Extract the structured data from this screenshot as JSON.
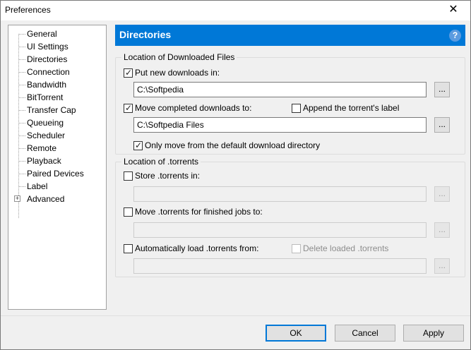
{
  "window": {
    "title": "Preferences",
    "close_glyph": "✕"
  },
  "tree": {
    "items": [
      {
        "label": "General"
      },
      {
        "label": "UI Settings"
      },
      {
        "label": "Directories"
      },
      {
        "label": "Connection"
      },
      {
        "label": "Bandwidth"
      },
      {
        "label": "BitTorrent"
      },
      {
        "label": "Transfer Cap"
      },
      {
        "label": "Queueing"
      },
      {
        "label": "Scheduler"
      },
      {
        "label": "Remote"
      },
      {
        "label": "Playback"
      },
      {
        "label": "Paired Devices"
      },
      {
        "label": "Label"
      },
      {
        "label": "Advanced"
      }
    ],
    "selected": "Directories",
    "expander_glyph": "+"
  },
  "panel": {
    "title": "Directories",
    "help_glyph": "?"
  },
  "downloaded": {
    "group_title": "Location of Downloaded Files",
    "put_new_label": "Put new downloads in:",
    "put_new_checked": true,
    "put_new_path": "C:\\Softpedia",
    "move_completed_label": "Move completed downloads to:",
    "move_completed_checked": true,
    "append_label": "Append the torrent's label",
    "append_checked": false,
    "move_completed_path": "C:\\Softpedia Files",
    "only_move_label": "Only move from the default download directory",
    "only_move_checked": true,
    "browse_label": "..."
  },
  "torrents": {
    "group_title": "Location of .torrents",
    "store_label": "Store .torrents in:",
    "store_checked": false,
    "store_path": "",
    "move_finished_label": "Move .torrents for finished jobs to:",
    "move_finished_checked": false,
    "move_finished_path": "",
    "autoload_label": "Automatically load .torrents from:",
    "autoload_checked": false,
    "delete_loaded_label": "Delete loaded .torrents",
    "delete_loaded_checked": false,
    "autoload_path": "",
    "browse_label": "..."
  },
  "footer": {
    "ok_label": "OK",
    "cancel_label": "Cancel",
    "apply_label": "Apply"
  },
  "colors": {
    "accent": "#0078d7",
    "header_text": "#ffffff"
  }
}
